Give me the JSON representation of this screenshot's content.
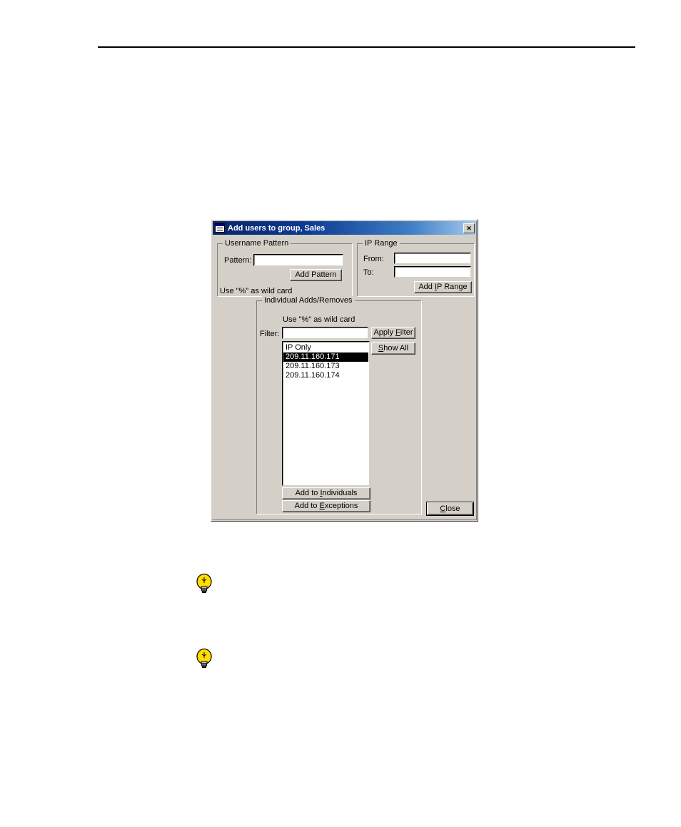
{
  "page": {
    "background_color": "#ffffff",
    "rule_color": "#000000",
    "tips": [
      {
        "icon": "lightbulb-icon",
        "color": "#ffdd00"
      },
      {
        "icon": "lightbulb-icon",
        "color": "#ffdd00"
      }
    ]
  },
  "dialog": {
    "title": "Add users to group, Sales",
    "title_icon": "window-form-icon",
    "titlebar_gradient_from": "#0a246a",
    "titlebar_gradient_to": "#a6caf0",
    "face_color": "#d4d0c8",
    "close_button_label": "✕",
    "username_pattern": {
      "group_label": "Username Pattern",
      "pattern_label": "Pattern:",
      "pattern_value": "",
      "pattern_placeholder": "",
      "add_pattern_button": "Add Pattern",
      "hint": "Use \"%\" as wild card"
    },
    "ip_range": {
      "group_label": "IP Range",
      "from_label": "From:",
      "from_value": "",
      "to_label": "To:",
      "to_value": "",
      "add_ip_range_button_pre": "Add ",
      "add_ip_range_button_accel": "I",
      "add_ip_range_button_post": "P Range"
    },
    "individual": {
      "group_label": "Individual Adds/Removes",
      "hint": "Use \"%\" as wild card",
      "filter_label": "Filter:",
      "filter_value": "",
      "apply_filter_button_pre": "Apply ",
      "apply_filter_button_accel": "F",
      "apply_filter_button_post": "ilter",
      "show_all_button_accel": "S",
      "show_all_button_post": "how All",
      "list_items": [
        {
          "label": "IP Only",
          "selected": false
        },
        {
          "label": "209.11.160.171",
          "selected": true
        },
        {
          "label": "209.11.160.173",
          "selected": false
        },
        {
          "label": "209.11.160.174",
          "selected": false
        }
      ],
      "add_individuals_button_pre": "Add to ",
      "add_individuals_button_accel": "I",
      "add_individuals_button_post": "ndividuals",
      "add_exceptions_button_pre": "Add to ",
      "add_exceptions_button_accel": "E",
      "add_exceptions_button_post": "xceptions"
    },
    "close_label_accel": "C",
    "close_label_post": "lose"
  }
}
